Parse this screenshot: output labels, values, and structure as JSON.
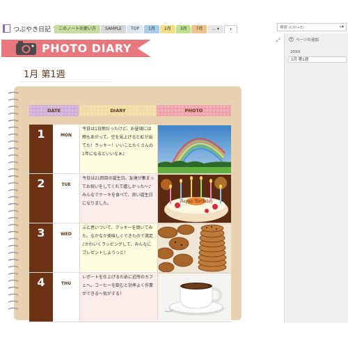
{
  "notebook": {
    "title": "つぶやき日記"
  },
  "tabs": [
    {
      "label": "このノートの使い方",
      "color": "#c5dea0"
    },
    {
      "label": "SAMPLE",
      "color": "#d8d8d8"
    },
    {
      "label": "TOP",
      "color": "#dde7ef"
    },
    {
      "label": "1月",
      "color": "#a8cde8"
    },
    {
      "label": "2月",
      "color": "#f3e08a"
    },
    {
      "label": "3月",
      "color": "#bfe28e"
    },
    {
      "label": "7月",
      "color": "#f2c48a"
    },
    {
      "label": "... ▾",
      "color": "#e6e6e6"
    },
    {
      "label": "+",
      "color": "#ffffff"
    }
  ],
  "search": {
    "placeholder": "検索 (Ctrl+E)"
  },
  "page_panel": {
    "add_page_label": "ページの追加",
    "pages": [
      {
        "label": "20XX",
        "selected": false
      },
      {
        "label": "1月 第1週",
        "selected": true
      }
    ]
  },
  "banner": {
    "title": "PHOTO DIARY",
    "color": "#e8777e"
  },
  "page_title": "1月 第1週",
  "table": {
    "headers": {
      "date": "DATE",
      "diary": "DIARY",
      "photo": "PHOTO"
    },
    "rows": [
      {
        "num": "1",
        "day": "MON",
        "diary": "今日は1日雨だったけど、お昼頃には雨もあがって、空を見上げると虹が出てた！ラッキー！いいことたくさんの1年になるといいなぁ♪",
        "photo": "rainbow-photo",
        "diary_bg": "#fdfde0"
      },
      {
        "num": "2",
        "day": "TUE",
        "diary": "今日は21回目の誕生日。友達が集まってお祝いをしてくれて嬉しかった～♪みんなでケーキを食べて、良い誕生日になりました。",
        "photo": "birthday-cake-photo",
        "diary_bg": "#fdecec"
      },
      {
        "num": "3",
        "day": "WED",
        "diary": "ふと思いついて、クッキーを焼いてみた。なかなか美味しくできたので満足♪かわいくラッピングして、みんなにプレゼントしようっと！",
        "photo": "cookies-photo",
        "diary_bg": "#fdfde0"
      },
      {
        "num": "4",
        "day": "THU",
        "diary": "レポートを仕上げるために近所のカフェへ。コーヒーを飲むと効率よく作業ができる～気がする！",
        "photo": "coffee-cup-photo",
        "diary_bg": "#fdecec"
      }
    ]
  }
}
